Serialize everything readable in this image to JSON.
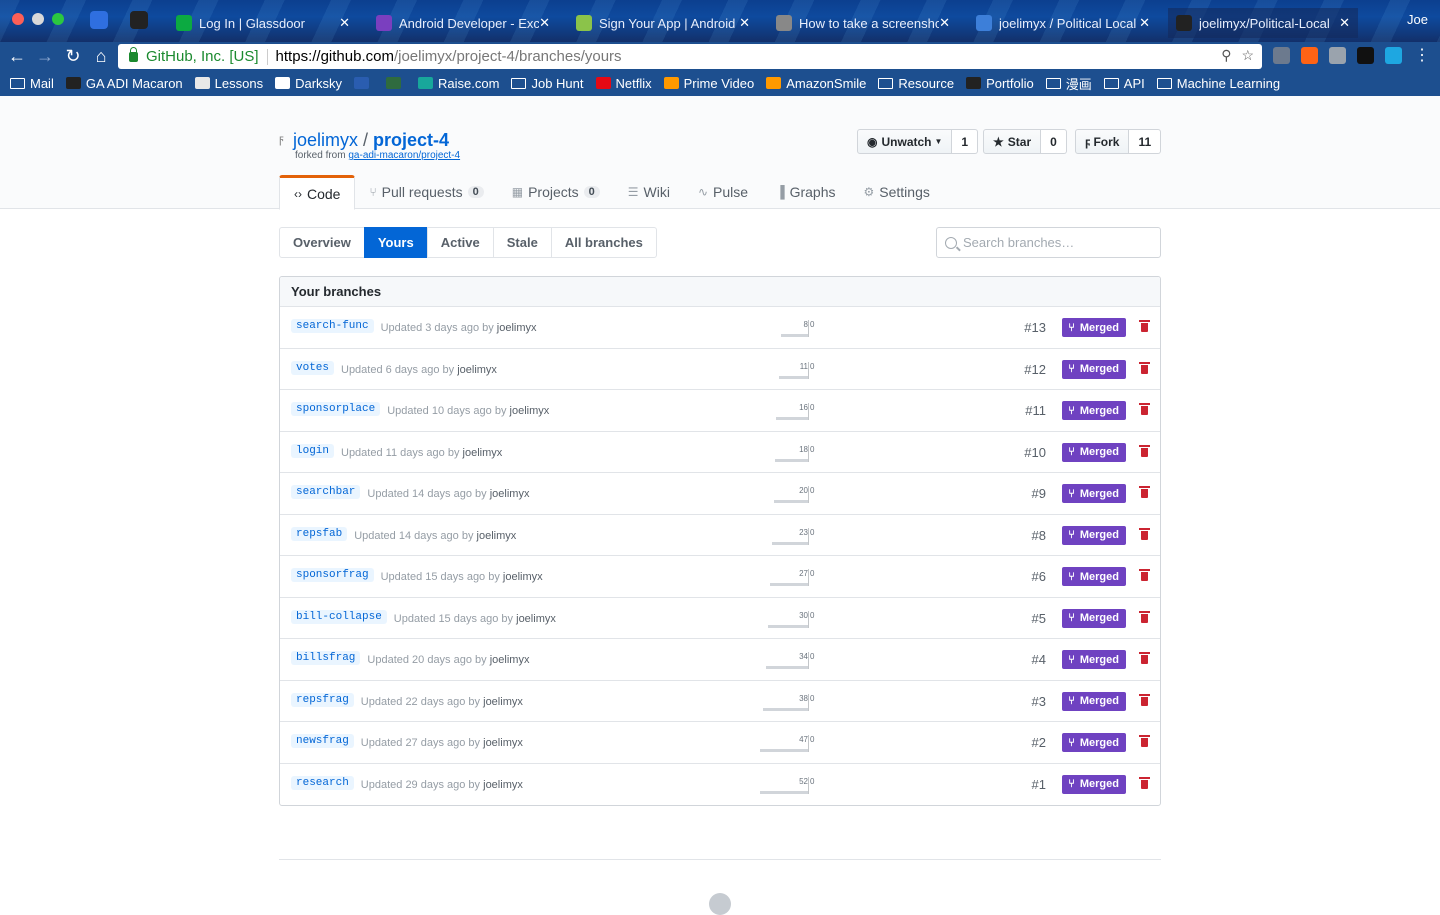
{
  "browser": {
    "tabs": [
      {
        "title": "",
        "pinned": true,
        "icon": "inbox-icon",
        "color": "#2f6fe0"
      },
      {
        "title": "",
        "pinned": true,
        "icon": "github-icon",
        "color": "#222222"
      },
      {
        "title": "Log In | Glassdoor",
        "icon": "glassdoor-icon",
        "color": "#0caa41"
      },
      {
        "title": "Android Developer - Excit",
        "icon": "android-icon",
        "color": "#7a3fbf"
      },
      {
        "title": "Sign Your App | Android S",
        "icon": "android-icon",
        "color": "#8bc34a"
      },
      {
        "title": "How to take a screenshot",
        "icon": "apple-icon",
        "color": "#888888"
      },
      {
        "title": "joelimyx / Political Local /",
        "icon": "repo-icon",
        "color": "#3d7fd9"
      },
      {
        "title": "joelimyx/Political-Local",
        "icon": "github-icon",
        "color": "#222222"
      }
    ],
    "profile": "Joe",
    "omnibox": {
      "ev_label": "GitHub, Inc. [US]",
      "url_host": "https://github.com",
      "url_path": "/joelimyx/project-4/branches/yours"
    },
    "bookmarks": [
      {
        "label": "Mail",
        "icon": "folder-icon"
      },
      {
        "label": "GA ADI Macaron",
        "icon": "github-icon"
      },
      {
        "label": "Lessons",
        "icon": "lessons-icon"
      },
      {
        "label": "Darksky",
        "icon": "darksky-icon"
      },
      {
        "label": "",
        "icon": "sd-icon"
      },
      {
        "label": "",
        "icon": "bn-icon"
      },
      {
        "label": "Raise.com",
        "icon": "raise-icon"
      },
      {
        "label": "Job Hunt",
        "icon": "folder-icon"
      },
      {
        "label": "Netflix",
        "icon": "netflix-icon"
      },
      {
        "label": "Prime Video",
        "icon": "amazon-icon"
      },
      {
        "label": "AmazonSmile",
        "icon": "amazon-icon"
      },
      {
        "label": "Resource",
        "icon": "folder-icon"
      },
      {
        "label": "Portfolio",
        "icon": "github-icon"
      },
      {
        "label": "漫画",
        "icon": "folder-icon"
      },
      {
        "label": "API",
        "icon": "folder-icon"
      },
      {
        "label": "Machine Learning",
        "icon": "folder-icon"
      }
    ]
  },
  "repo": {
    "owner": "joelimyx",
    "separator": " / ",
    "name": "project-4",
    "forked_prefix": "forked from ",
    "forked_from": "ga-adi-macaron/project-4",
    "watch": {
      "label": "Unwatch",
      "count": "1"
    },
    "star": {
      "label": "Star",
      "count": "0"
    },
    "fork": {
      "label": "Fork",
      "count": "11"
    },
    "nav": [
      {
        "label": "Code",
        "icon": "code-icon",
        "count": null,
        "selected": true
      },
      {
        "label": "Pull requests",
        "icon": "pull-request-icon",
        "count": "0"
      },
      {
        "label": "Projects",
        "icon": "project-icon",
        "count": "0"
      },
      {
        "label": "Wiki",
        "icon": "wiki-icon",
        "count": null
      },
      {
        "label": "Pulse",
        "icon": "pulse-icon",
        "count": null
      },
      {
        "label": "Graphs",
        "icon": "graph-icon",
        "count": null
      },
      {
        "label": "Settings",
        "icon": "gear-icon",
        "count": null
      }
    ]
  },
  "branches": {
    "filters": [
      "Overview",
      "Yours",
      "Active",
      "Stale",
      "All branches"
    ],
    "selected_filter": "Yours",
    "search_placeholder": "Search branches…",
    "header": "Your branches",
    "merged_label": "Merged",
    "rows": [
      {
        "name": "search-func",
        "updated": "Updated 3 days ago by",
        "user": "joelimyx",
        "behind": "8",
        "ahead": "0",
        "pr": "#13"
      },
      {
        "name": "votes",
        "updated": "Updated 6 days ago by",
        "user": "joelimyx",
        "behind": "11",
        "ahead": "0",
        "pr": "#12"
      },
      {
        "name": "sponsorplace",
        "updated": "Updated 10 days ago by",
        "user": "joelimyx",
        "behind": "16",
        "ahead": "0",
        "pr": "#11"
      },
      {
        "name": "login",
        "updated": "Updated 11 days ago by",
        "user": "joelimyx",
        "behind": "18",
        "ahead": "0",
        "pr": "#10"
      },
      {
        "name": "searchbar",
        "updated": "Updated 14 days ago by",
        "user": "joelimyx",
        "behind": "20",
        "ahead": "0",
        "pr": "#9"
      },
      {
        "name": "repsfab",
        "updated": "Updated 14 days ago by",
        "user": "joelimyx",
        "behind": "23",
        "ahead": "0",
        "pr": "#8"
      },
      {
        "name": "sponsorfrag",
        "updated": "Updated 15 days ago by",
        "user": "joelimyx",
        "behind": "27",
        "ahead": "0",
        "pr": "#6"
      },
      {
        "name": "bill-collapse",
        "updated": "Updated 15 days ago by",
        "user": "joelimyx",
        "behind": "30",
        "ahead": "0",
        "pr": "#5"
      },
      {
        "name": "billsfrag",
        "updated": "Updated 20 days ago by",
        "user": "joelimyx",
        "behind": "34",
        "ahead": "0",
        "pr": "#4"
      },
      {
        "name": "repsfrag",
        "updated": "Updated 22 days ago by",
        "user": "joelimyx",
        "behind": "38",
        "ahead": "0",
        "pr": "#3"
      },
      {
        "name": "newsfrag",
        "updated": "Updated 27 days ago by",
        "user": "joelimyx",
        "behind": "47",
        "ahead": "0",
        "pr": "#2"
      },
      {
        "name": "research",
        "updated": "Updated 29 days ago by",
        "user": "joelimyx",
        "behind": "52",
        "ahead": "0",
        "pr": "#1"
      }
    ]
  },
  "colors": {
    "link": "#0366d6",
    "merged": "#6f42c1",
    "delete": "#cb2431",
    "accent_tab": "#e36209"
  }
}
